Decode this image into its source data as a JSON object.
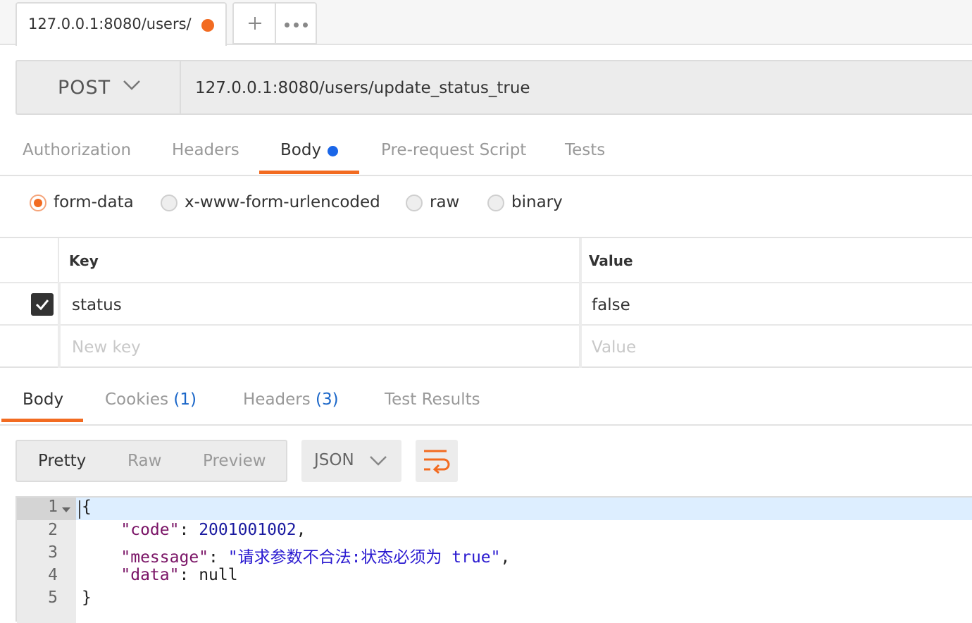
{
  "tab": {
    "title": "127.0.0.1:8080/users/",
    "new_tab_icon": "plus-icon",
    "more_icon": "ellipsis-icon",
    "unsaved_color": "#f26b21"
  },
  "request": {
    "method": "POST",
    "url": "127.0.0.1:8080/users/update_status_true"
  },
  "request_tabs": [
    "Authorization",
    "Headers",
    "Body",
    "Pre-request Script",
    "Tests"
  ],
  "request_tab_active": "Body",
  "body_types": [
    "form-data",
    "x-www-form-urlencoded",
    "raw",
    "binary"
  ],
  "body_type_selected": "form-data",
  "form_table": {
    "headers": {
      "key": "Key",
      "value": "Value"
    },
    "rows": [
      {
        "enabled": true,
        "key": "status",
        "value": "false"
      }
    ],
    "new_row": {
      "key_placeholder": "New key",
      "value_placeholder": "Value"
    }
  },
  "response_tabs": {
    "body": "Body",
    "cookies": "Cookies",
    "cookies_count": "(1)",
    "headers": "Headers",
    "headers_count": "(3)",
    "test_results": "Test Results"
  },
  "response_view": {
    "modes": [
      "Pretty",
      "Raw",
      "Preview"
    ],
    "active_mode": "Pretty",
    "format": "JSON",
    "wrap_icon": "wrap-lines-icon"
  },
  "response_code": {
    "line_numbers": [
      "1",
      "2",
      "3",
      "4",
      "5"
    ],
    "open_brace": "{",
    "close_brace": "}",
    "code_key": "\"code\"",
    "code_value": "2001001002",
    "message_key": "\"message\"",
    "message_value": "\"请求参数不合法:状态必须为 true\"",
    "data_key": "\"data\"",
    "data_value": "null"
  },
  "colors": {
    "accent": "#f26b21",
    "link_blue": "#1a66c8",
    "body_dot": "#1a66e8"
  }
}
